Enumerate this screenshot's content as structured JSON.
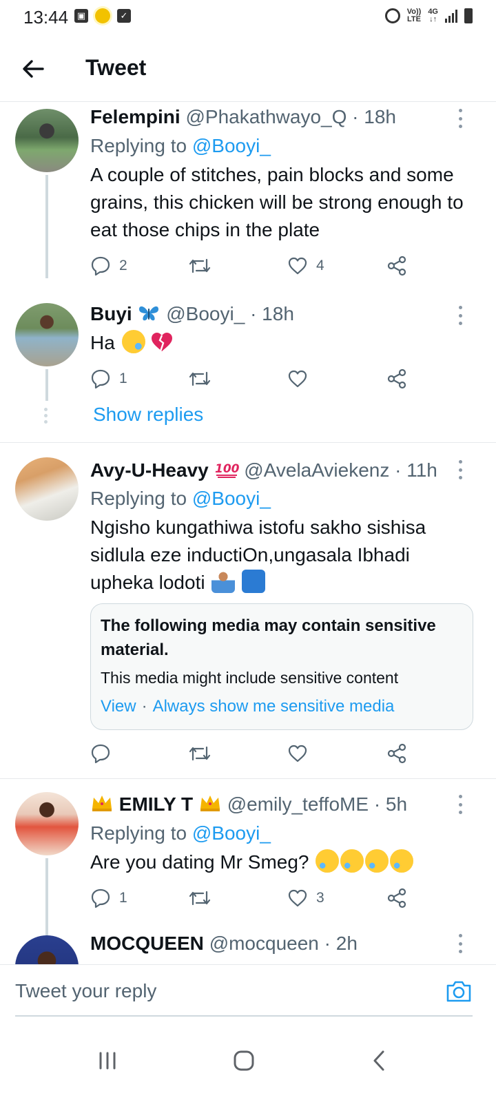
{
  "status_bar": {
    "time": "13:44",
    "volte_label": "Vo))",
    "lte_label": "LTE",
    "network_label": "4G"
  },
  "header": {
    "title": "Tweet"
  },
  "tweets": [
    {
      "name": "Felempini",
      "handle": "@Phakathwayo_Q",
      "time": "· 18h",
      "replying_prefix": "Replying to ",
      "replying_to": "@Booyi_",
      "text": "A couple of stitches, pain blocks and some grains, this chicken will be strong enough to eat those chips in the plate",
      "reply_count": "2",
      "retweet_count": "",
      "like_count": "4"
    },
    {
      "name": "Buyi",
      "handle": "@Booyi_",
      "time": "· 18h",
      "text": "Ha",
      "reply_count": "1",
      "retweet_count": "",
      "like_count": ""
    },
    {
      "name": "Avy-U-Heavy",
      "handle": "@AvelaAviekenz",
      "time": "· 11h",
      "replying_prefix": "Replying to ",
      "replying_to": "@Booyi_",
      "text": "Ngisho kungathiwa istofu sakho sishisa sidlula eze inductiOn,ungasala Ibhadi upheka lodoti",
      "reply_count": "",
      "retweet_count": "",
      "like_count": ""
    },
    {
      "name": "EMILY T",
      "handle": "@emily_teffoME",
      "time": "· 5h",
      "replying_prefix": "Replying to ",
      "replying_to": "@Booyi_",
      "text": "Are you dating Mr Smeg?",
      "reply_count": "1",
      "retweet_count": "",
      "like_count": "3"
    },
    {
      "name": "MOCQUEEN",
      "handle": "@mocqueen",
      "time": "· 2h"
    }
  ],
  "show_replies": "Show replies",
  "sensitive": {
    "title": "The following media may contain sensitive material.",
    "description": "This media might include sensitive content",
    "view_label": "View",
    "separator": "·",
    "always_show_label": "Always show me sensitive media"
  },
  "reply_bar": {
    "placeholder": "Tweet your reply"
  },
  "icons": {
    "back": "arrow-left-icon",
    "reply": "speech-bubble-icon",
    "retweet": "retweet-icon",
    "like": "heart-icon",
    "share": "share-icon",
    "camera": "camera-icon"
  },
  "colors": {
    "accent": "#1d9bf0",
    "text": "#0f1419",
    "muted": "#536471"
  }
}
